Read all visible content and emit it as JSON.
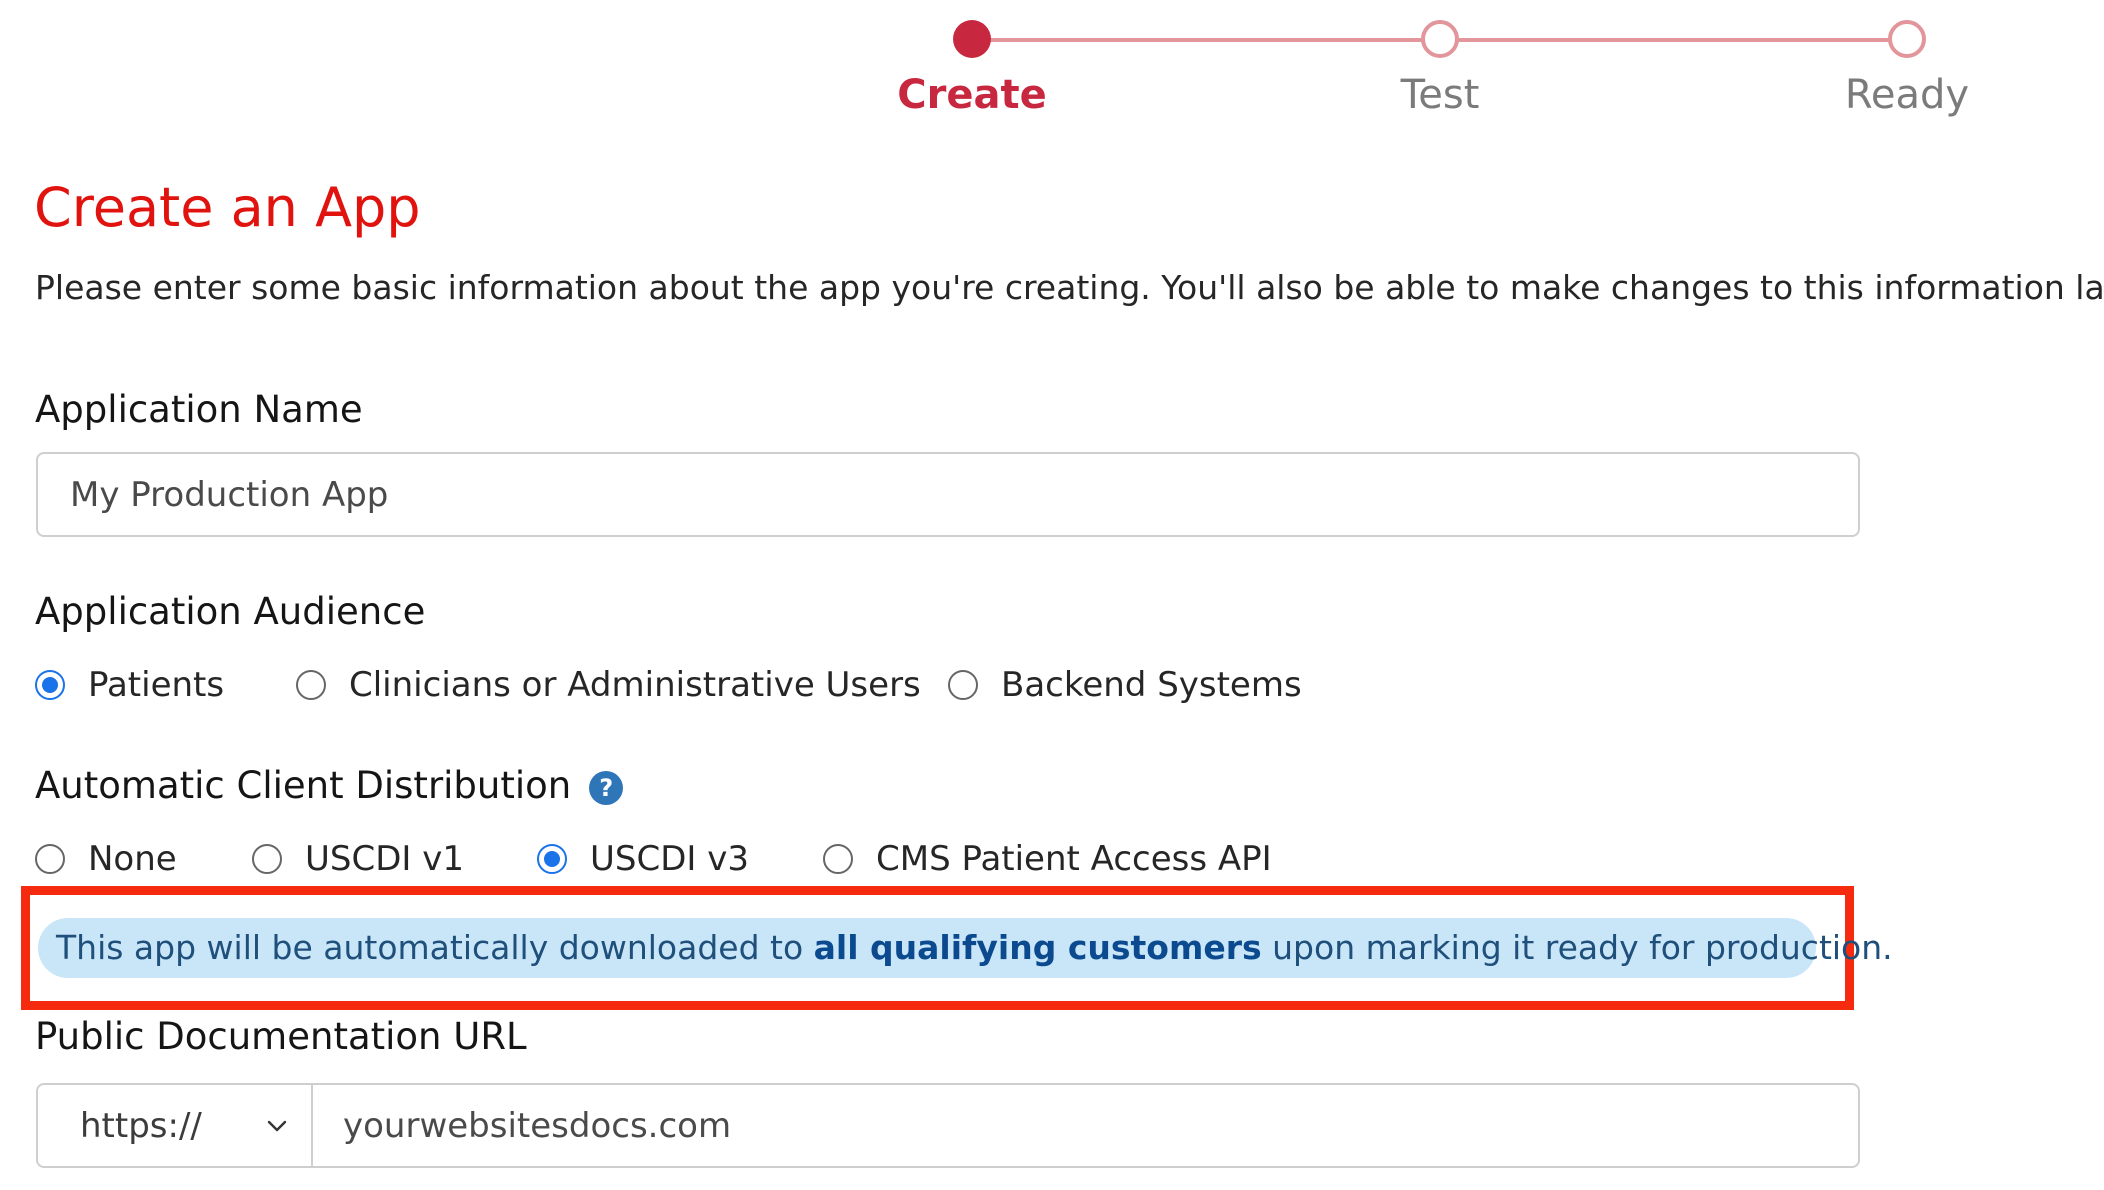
{
  "stepper": {
    "steps": [
      {
        "label": "Create",
        "state": "active"
      },
      {
        "label": "Test",
        "state": "inactive"
      },
      {
        "label": "Ready",
        "state": "inactive"
      }
    ],
    "active_color": "#c8283f",
    "inactive_color": "#e2959b"
  },
  "page": {
    "title": "Create an App",
    "intro": "Please enter some basic information about the app you're creating. You'll also be able to make changes to this information later."
  },
  "app_name": {
    "label": "Application Name",
    "placeholder": "My Production App"
  },
  "audience": {
    "label": "Application Audience",
    "options": [
      {
        "label": "Patients",
        "selected": true
      },
      {
        "label": "Clinicians or Administrative Users",
        "selected": false
      },
      {
        "label": "Backend Systems",
        "selected": false
      }
    ]
  },
  "distribution": {
    "label": "Automatic Client Distribution",
    "help_icon": "question-circle-icon",
    "options": [
      {
        "label": "None",
        "selected": false
      },
      {
        "label": "USCDI v1",
        "selected": false
      },
      {
        "label": "USCDI v3",
        "selected": true
      },
      {
        "label": "CMS Patient Access API",
        "selected": false
      }
    ],
    "info_before": "This app will be automatically downloaded to ",
    "info_bold": "all qualifying customers",
    "info_after": " upon marking it ready for production."
  },
  "docs_url": {
    "label": "Public Documentation URL",
    "protocol": "https://",
    "placeholder": "yourwebsitesdocs.com"
  },
  "colors": {
    "title": "#e1130f",
    "radio_selected": "#1a73e8",
    "info_background": "#c9e6f9",
    "highlight_border": "#f52a0e"
  }
}
